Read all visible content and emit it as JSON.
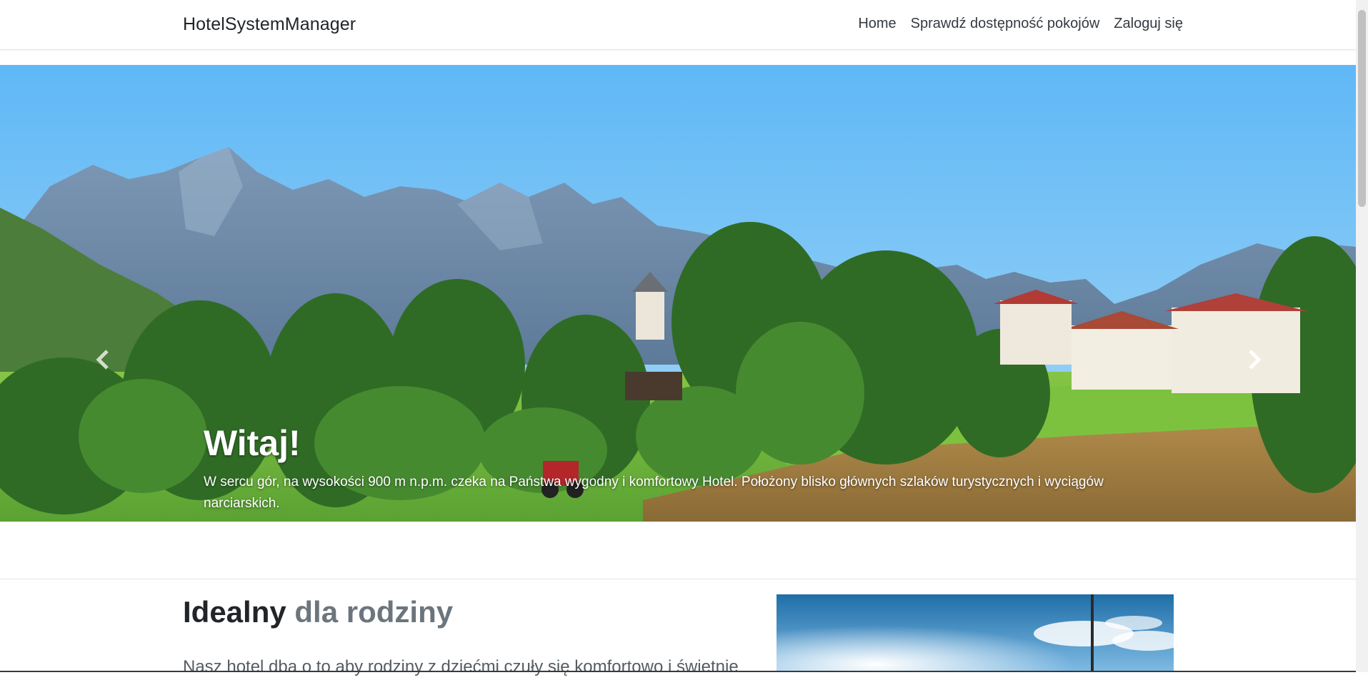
{
  "navbar": {
    "brand": "HotelSystemManager",
    "links": [
      {
        "label": "Home"
      },
      {
        "label": "Sprawdź dostępność pokojów"
      },
      {
        "label": "Zaloguj się"
      }
    ]
  },
  "carousel": {
    "title": "Witaj!",
    "text": "W sercu gór, na wysokości 900 m n.p.m. czeka na Państwa wygodny i komfortowy Hotel. Położony blisko głównych szlaków turystycznych i wyciągów narciarskich.",
    "prev_icon": "chevron-left-icon",
    "next_icon": "chevron-right-icon",
    "slides_count": 3,
    "active_slide": 1
  },
  "feature": {
    "heading_main": "Idealny",
    "heading_muted": "dla rodziny",
    "lead": "Nasz hotel dba o to aby rodziny z dziećmi czuły się komfortowo i świetnie"
  },
  "colors": {
    "sky_top": "#5fb8f6",
    "sky_bottom": "#9dd3f5",
    "grass": "#6fb83a",
    "muted_text": "#6c757d"
  }
}
